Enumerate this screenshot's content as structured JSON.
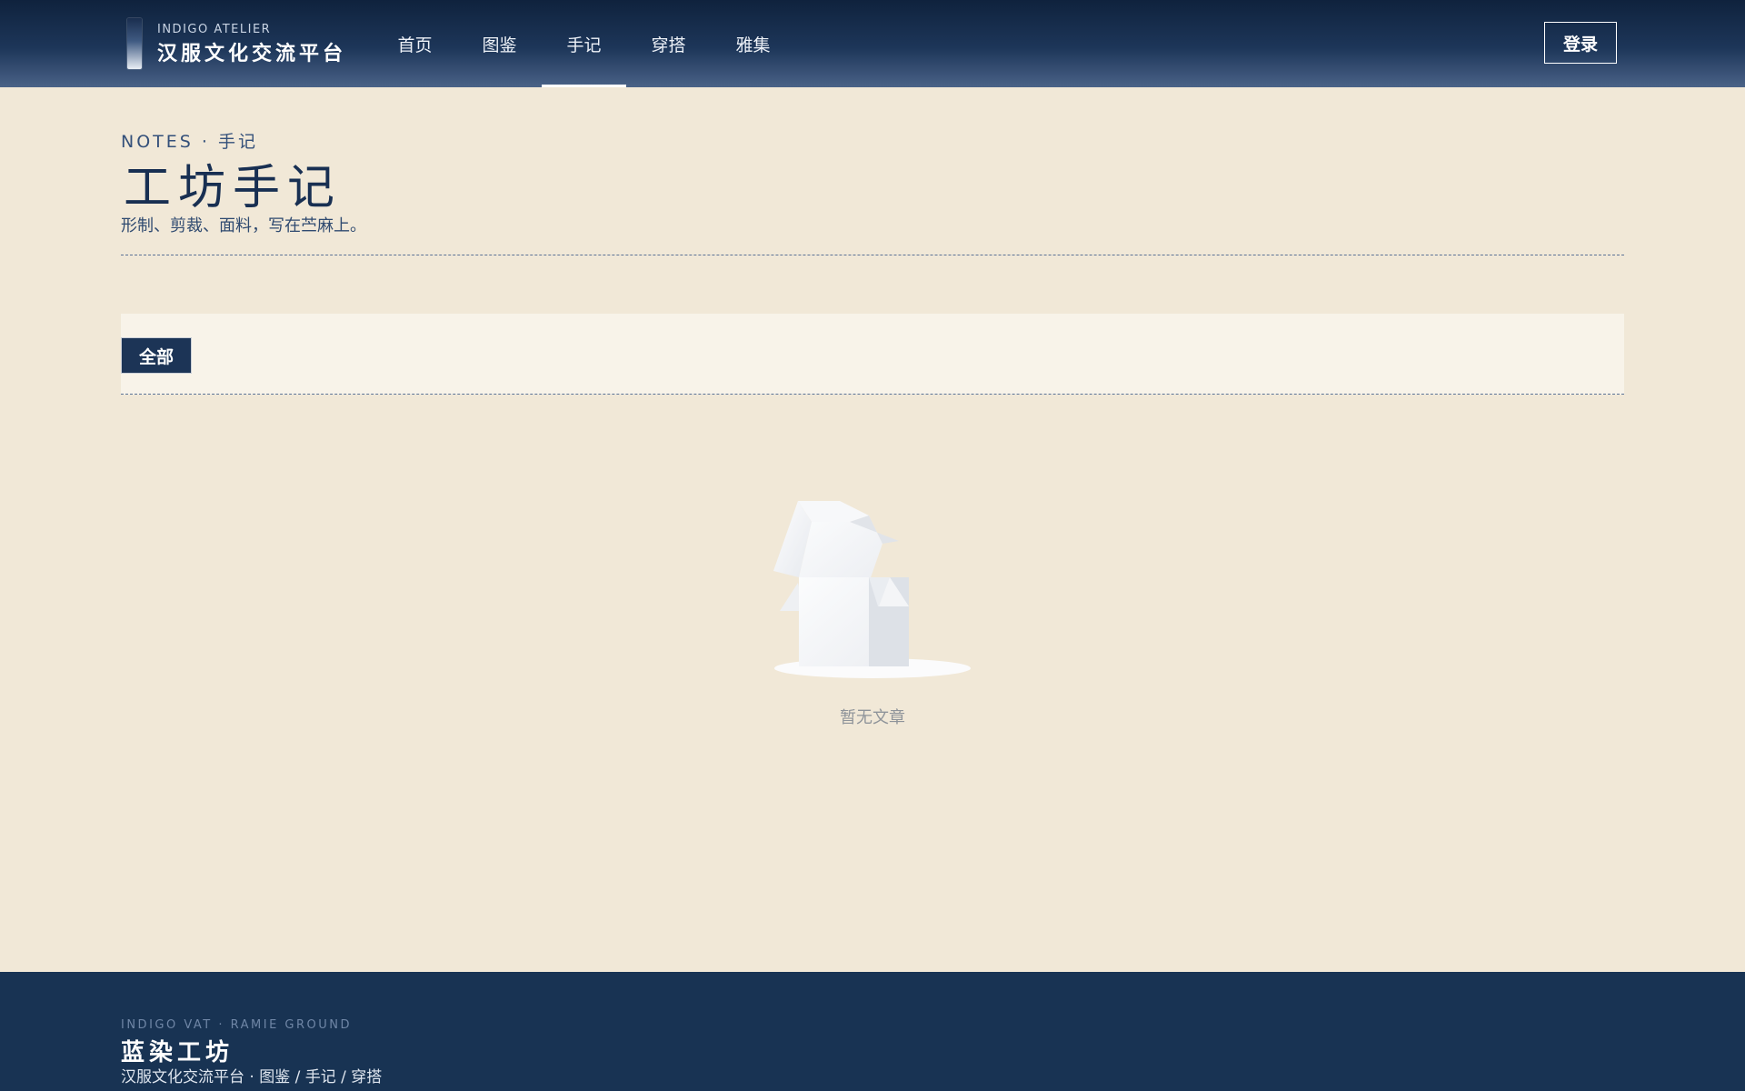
{
  "header": {
    "brand_sub": "INDIGO ATELIER",
    "brand_main": "汉服文化交流平台",
    "nav": [
      {
        "label": "首页"
      },
      {
        "label": "图鉴"
      },
      {
        "label": "手记",
        "active": true
      },
      {
        "label": "穿搭"
      },
      {
        "label": "雅集"
      }
    ],
    "login_label": "登录"
  },
  "page": {
    "eyebrow": "NOTES · 手记",
    "title": "工坊手记",
    "description": "形制、剪裁、面料，写在苎麻上。"
  },
  "filters": {
    "items": [
      {
        "label": "全部",
        "active": true
      }
    ]
  },
  "empty_state": {
    "text": "暂无文章",
    "icon": "empty-box-icon"
  },
  "footer": {
    "sub": "INDIGO VAT · RAMIE GROUND",
    "title": "蓝染工坊",
    "links": "汉服文化交流平台 · 图鉴 / 手记 / 穿搭"
  },
  "colors": {
    "page_bg": "#f1e8d7",
    "indigo": "#1c3456",
    "footer_bg": "#183353"
  }
}
